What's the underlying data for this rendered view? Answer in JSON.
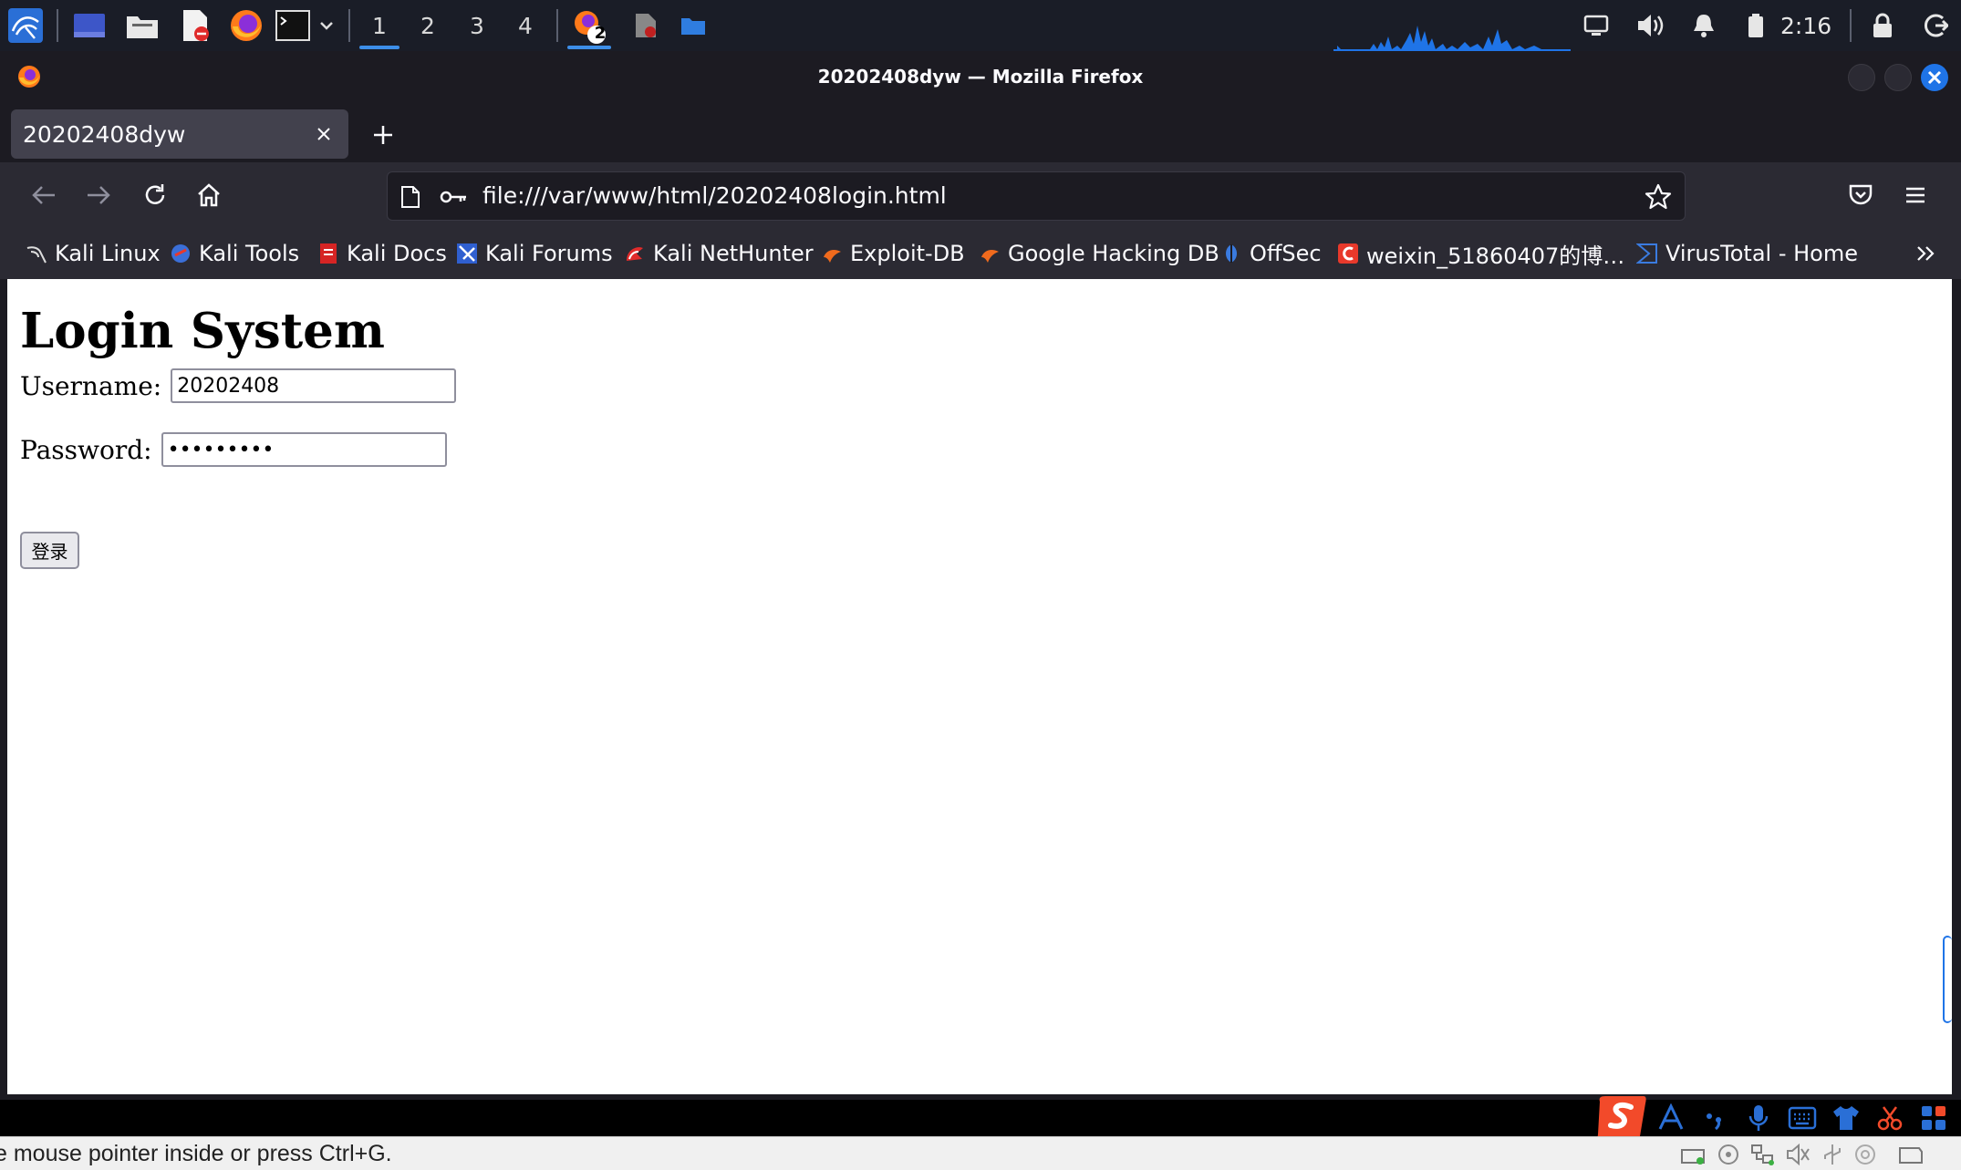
{
  "panel": {
    "workspaces": [
      "1",
      "2",
      "3",
      "4"
    ],
    "firefox_window_count": "2",
    "clock": "2:16",
    "icons": [
      "kali-menu-icon",
      "desktop-icon",
      "files-icon",
      "text-editor-icon",
      "firefox-icon",
      "terminal-icon",
      "volume-icon",
      "notification-icon",
      "battery-icon",
      "lock-icon",
      "logout-icon"
    ]
  },
  "window": {
    "title": "20202408dyw — Mozilla Firefox"
  },
  "tabs": [
    {
      "label": "20202408dyw",
      "active": true
    }
  ],
  "navbar": {
    "url": "file:///var/www/html/20202408login.html"
  },
  "bookmarks": [
    {
      "label": "Kali Linux"
    },
    {
      "label": "Kali Tools"
    },
    {
      "label": "Kali Docs"
    },
    {
      "label": "Kali Forums"
    },
    {
      "label": "Kali NetHunter"
    },
    {
      "label": "Exploit-DB"
    },
    {
      "label": "Google Hacking DB"
    },
    {
      "label": "OffSec"
    },
    {
      "label": "weixin_51860407的博…"
    },
    {
      "label": "VirusTotal - Home"
    }
  ],
  "page": {
    "heading": "Login System",
    "username_label": "Username:",
    "username_value": "20202408",
    "password_label": "Password:",
    "password_value": "123456789",
    "login_button": "登录"
  },
  "status": {
    "text": "e mouse pointer inside or press Ctrl+G."
  },
  "colors": {
    "panel_bg": "#1a1d27",
    "firefox_dark": "#1c1b22",
    "toolbar": "#2b2a33",
    "accent": "#1f74e7",
    "ime_red": "#f24a2a"
  }
}
